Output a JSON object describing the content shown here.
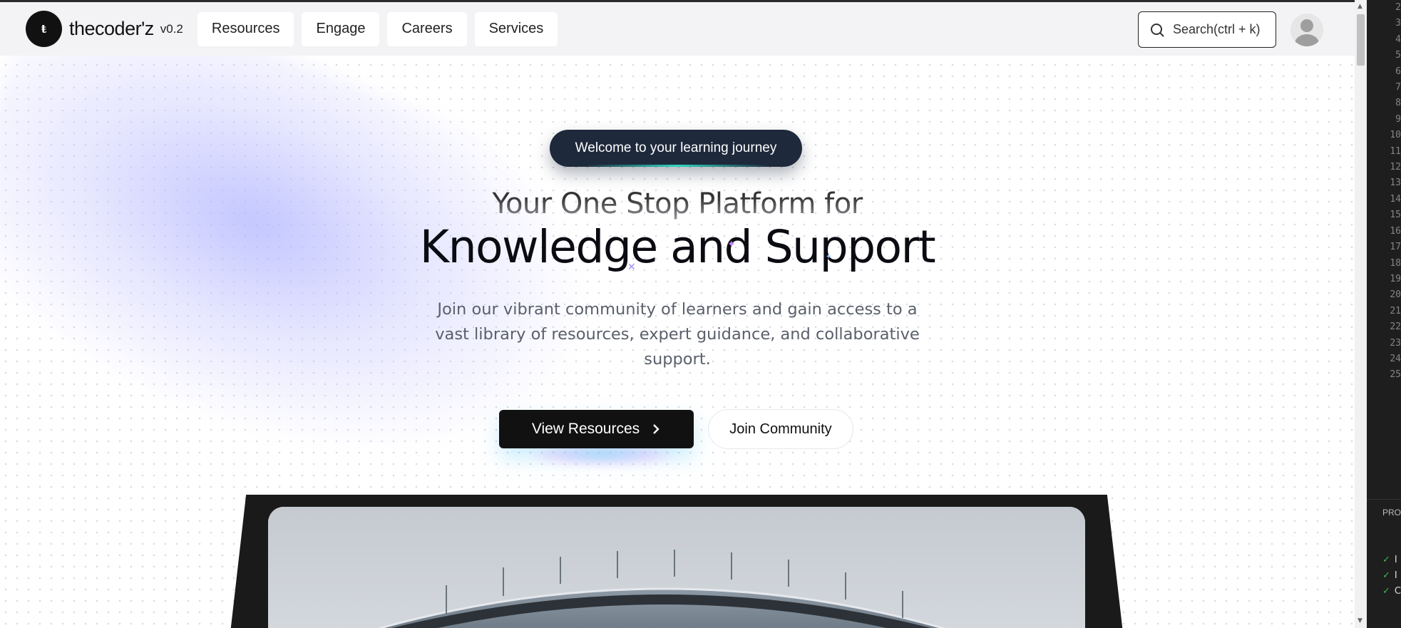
{
  "navbar": {
    "logo_glyph": "ŧ",
    "brand": "thecoder'z",
    "version": "v0.2",
    "items": [
      {
        "label": "Resources"
      },
      {
        "label": "Engage"
      },
      {
        "label": "Careers"
      },
      {
        "label": "Services"
      }
    ],
    "search_label": "Search(ctrl + k)"
  },
  "hero": {
    "pill": "Welcome to your learning journey",
    "headline_1": "Your One Stop Platform for",
    "headline_2": "Knowledge and Support",
    "subtext": "Join our vibrant community of learners and gain access to a vast library of resources, expert guidance, and collaborative support.",
    "primary_button": "View Resources",
    "secondary_button": "Join Community"
  },
  "side_panel": {
    "line_numbers": [
      "2",
      "3",
      "4",
      "5",
      "6",
      "7",
      "8",
      "9",
      "10",
      "11",
      "12",
      "13",
      "14",
      "15",
      "16",
      "17",
      "18",
      "19",
      "20",
      "21",
      "22",
      "23",
      "24",
      "25"
    ],
    "label": "PRO",
    "checks": [
      "I",
      "I",
      "C"
    ]
  },
  "colors": {
    "pill_bg": "#1e293b",
    "primary_button_bg": "#111111",
    "accent_glow": "#2dd4bf"
  }
}
